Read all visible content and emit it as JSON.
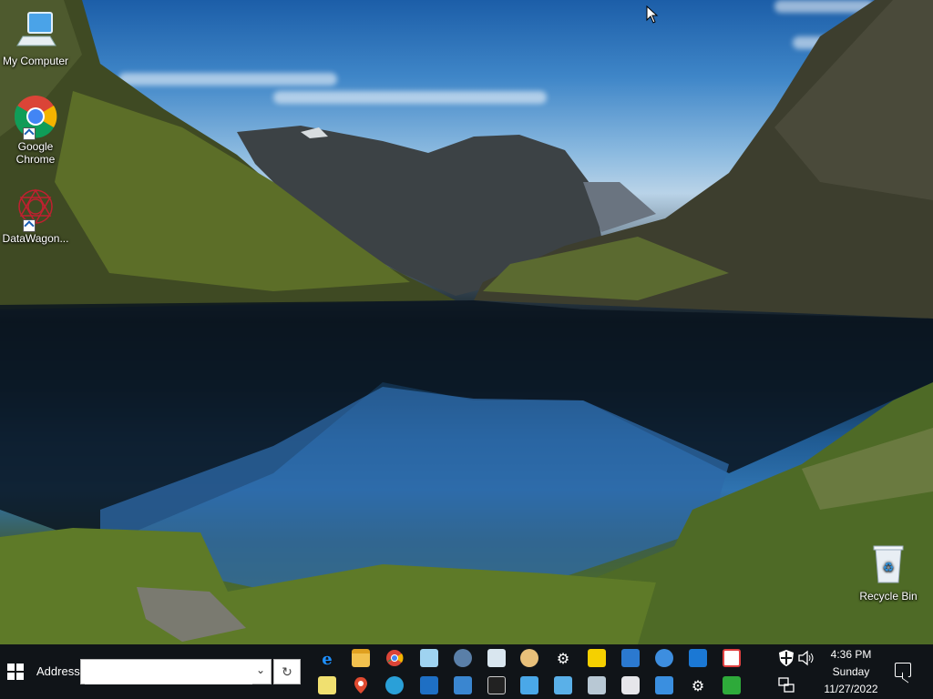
{
  "desktop": {
    "icons": [
      {
        "label": "My Computer",
        "icon": "computer-icon"
      },
      {
        "label": "Google\nChrome",
        "icon": "chrome-icon"
      },
      {
        "label": "DataWagon...",
        "icon": "datawagon-icon"
      },
      {
        "label": "Recycle Bin",
        "icon": "recycle-bin-icon"
      }
    ]
  },
  "taskbar": {
    "address_label": "Address",
    "address_value": "",
    "quicklaunch_top": [
      "internet-explorer-icon",
      "folder-icon",
      "chrome-icon",
      "notepad-icon",
      "network-icon",
      "edit-icon",
      "paint-icon",
      "settings-icon",
      "sticky-notes-icon",
      "photos-icon",
      "people-icon",
      "store-icon",
      "apps-icon"
    ],
    "quicklaunch_bottom": [
      "notes-icon",
      "maps-icon",
      "edge-icon",
      "picture-icon",
      "remote-desktop-icon",
      "terminal-icon",
      "contact-card-icon",
      "media-icon",
      "scanner-icon",
      "camera-icon",
      "display-icon",
      "gear-icon",
      "spreadsheet-icon"
    ],
    "clock": {
      "time": "4:36 PM",
      "day": "Sunday",
      "date": "11/27/2022"
    }
  }
}
